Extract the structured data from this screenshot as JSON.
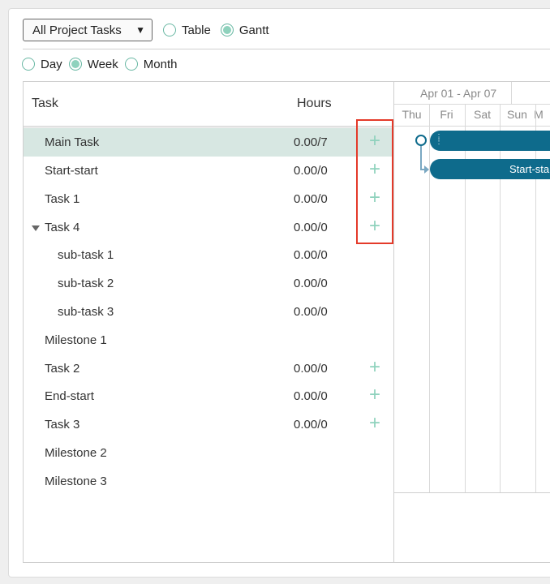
{
  "toolbar": {
    "filter_select": "All Project Tasks",
    "view_table": "Table",
    "view_gantt": "Gantt",
    "selected_view": "Gantt"
  },
  "scale": {
    "day": "Day",
    "week": "Week",
    "month": "Month",
    "selected": "Week"
  },
  "columns": {
    "task": "Task",
    "hours": "Hours"
  },
  "rows": [
    {
      "name": "Main Task",
      "hours": "0.00/7",
      "add": "+",
      "selected": true
    },
    {
      "name": "Start-start",
      "hours": "0.00/0",
      "add": "+"
    },
    {
      "name": "Task 1",
      "hours": "0.00/0",
      "add": "+"
    },
    {
      "name": "Task 4",
      "hours": "0.00/0",
      "add": "+",
      "expanded": true
    },
    {
      "name": "sub-task 1",
      "hours": "0.00/0"
    },
    {
      "name": "sub-task 2",
      "hours": "0.00/0"
    },
    {
      "name": "sub-task 3",
      "hours": "0.00/0"
    },
    {
      "name": "Milestone 1",
      "hours": ""
    },
    {
      "name": "Task 2",
      "hours": "0.00/0",
      "add": "+"
    },
    {
      "name": "End-start",
      "hours": "0.00/0",
      "add": "+"
    },
    {
      "name": "Task 3",
      "hours": "0.00/0",
      "add": "+"
    },
    {
      "name": "Milestone 2",
      "hours": ""
    },
    {
      "name": "Milestone 3",
      "hours": ""
    }
  ],
  "gantt": {
    "week_label": "Apr 01 - Apr 07",
    "days": [
      "Thu",
      "Fri",
      "Sat",
      "Sun",
      "M"
    ],
    "bar_label": "Start-sta",
    "bar_color": "#0e6b8c"
  },
  "colors": {
    "accent": "#8fd2bd",
    "selected_row": "#d7e7e2",
    "highlight": "#e43a2a"
  }
}
